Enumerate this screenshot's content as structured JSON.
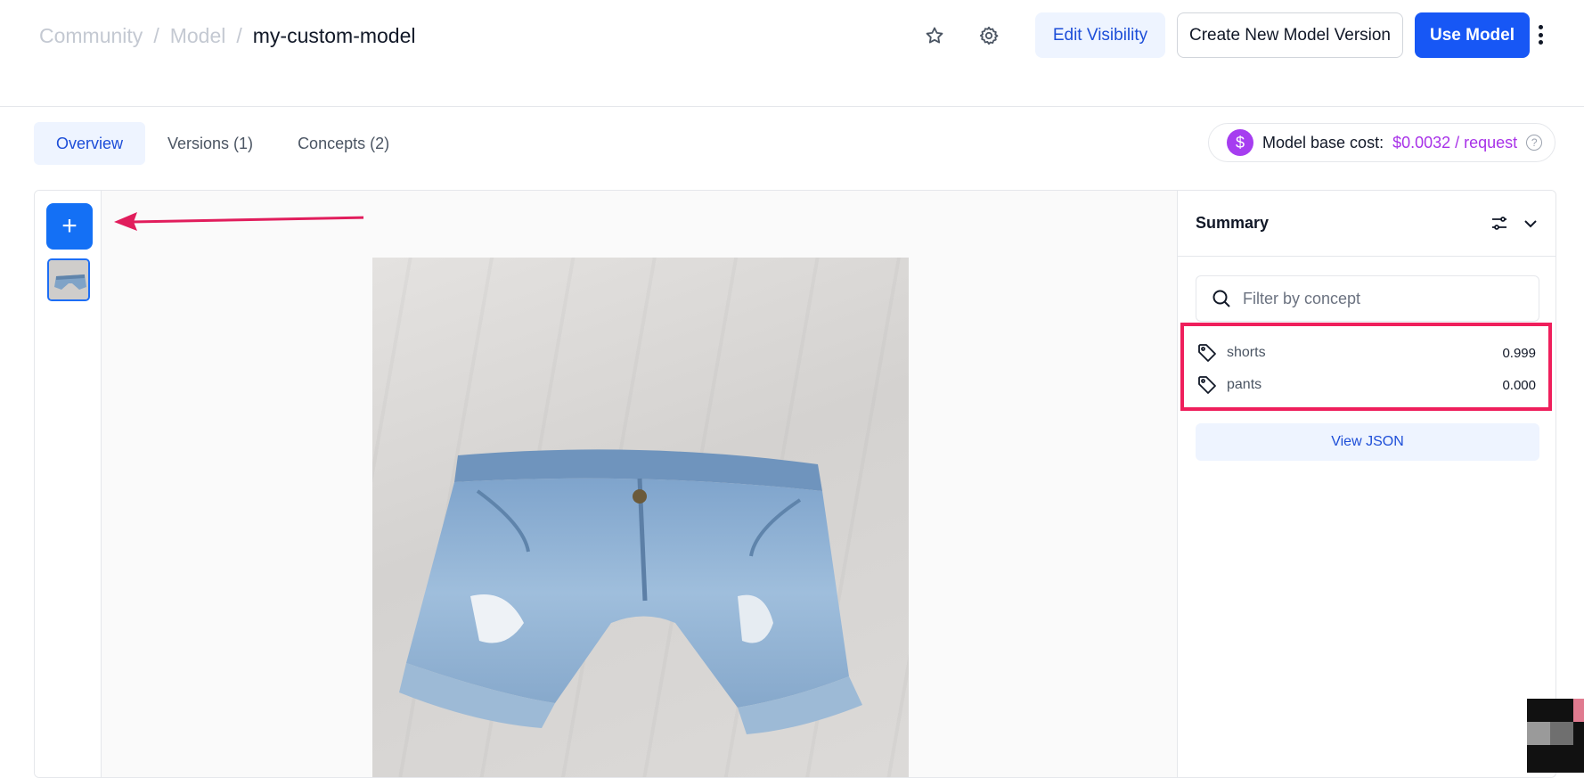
{
  "breadcrumb": {
    "community": "Community",
    "model": "Model",
    "separator": "/",
    "current": "my-custom-model"
  },
  "header": {
    "star_icon": "star-icon",
    "settings_icon": "gear-icon",
    "edit_visibility_label": "Edit Visibility",
    "create_version_label": "Create New Model Version",
    "use_model_label": "Use Model",
    "more_icon": "kebab-menu-icon"
  },
  "tabs": [
    {
      "label": "Overview",
      "active": true
    },
    {
      "label": "Versions (1)",
      "active": false
    },
    {
      "label": "Concepts (2)",
      "active": false
    }
  ],
  "cost": {
    "icon": "$",
    "label": "Model base cost:",
    "value": "$0.0032 / request",
    "help_icon": "?"
  },
  "rail": {
    "add_label": "+"
  },
  "summary": {
    "title": "Summary",
    "filter_placeholder": "Filter by concept",
    "concepts": [
      {
        "name": "shorts",
        "value": "0.999"
      },
      {
        "name": "pants",
        "value": "0.000"
      }
    ],
    "view_json_label": "View JSON"
  },
  "colors": {
    "primary": "#1757f5",
    "add_button": "#1470f5",
    "accent_purple": "#a832e8",
    "highlight_pink": "#ef1f5c"
  }
}
